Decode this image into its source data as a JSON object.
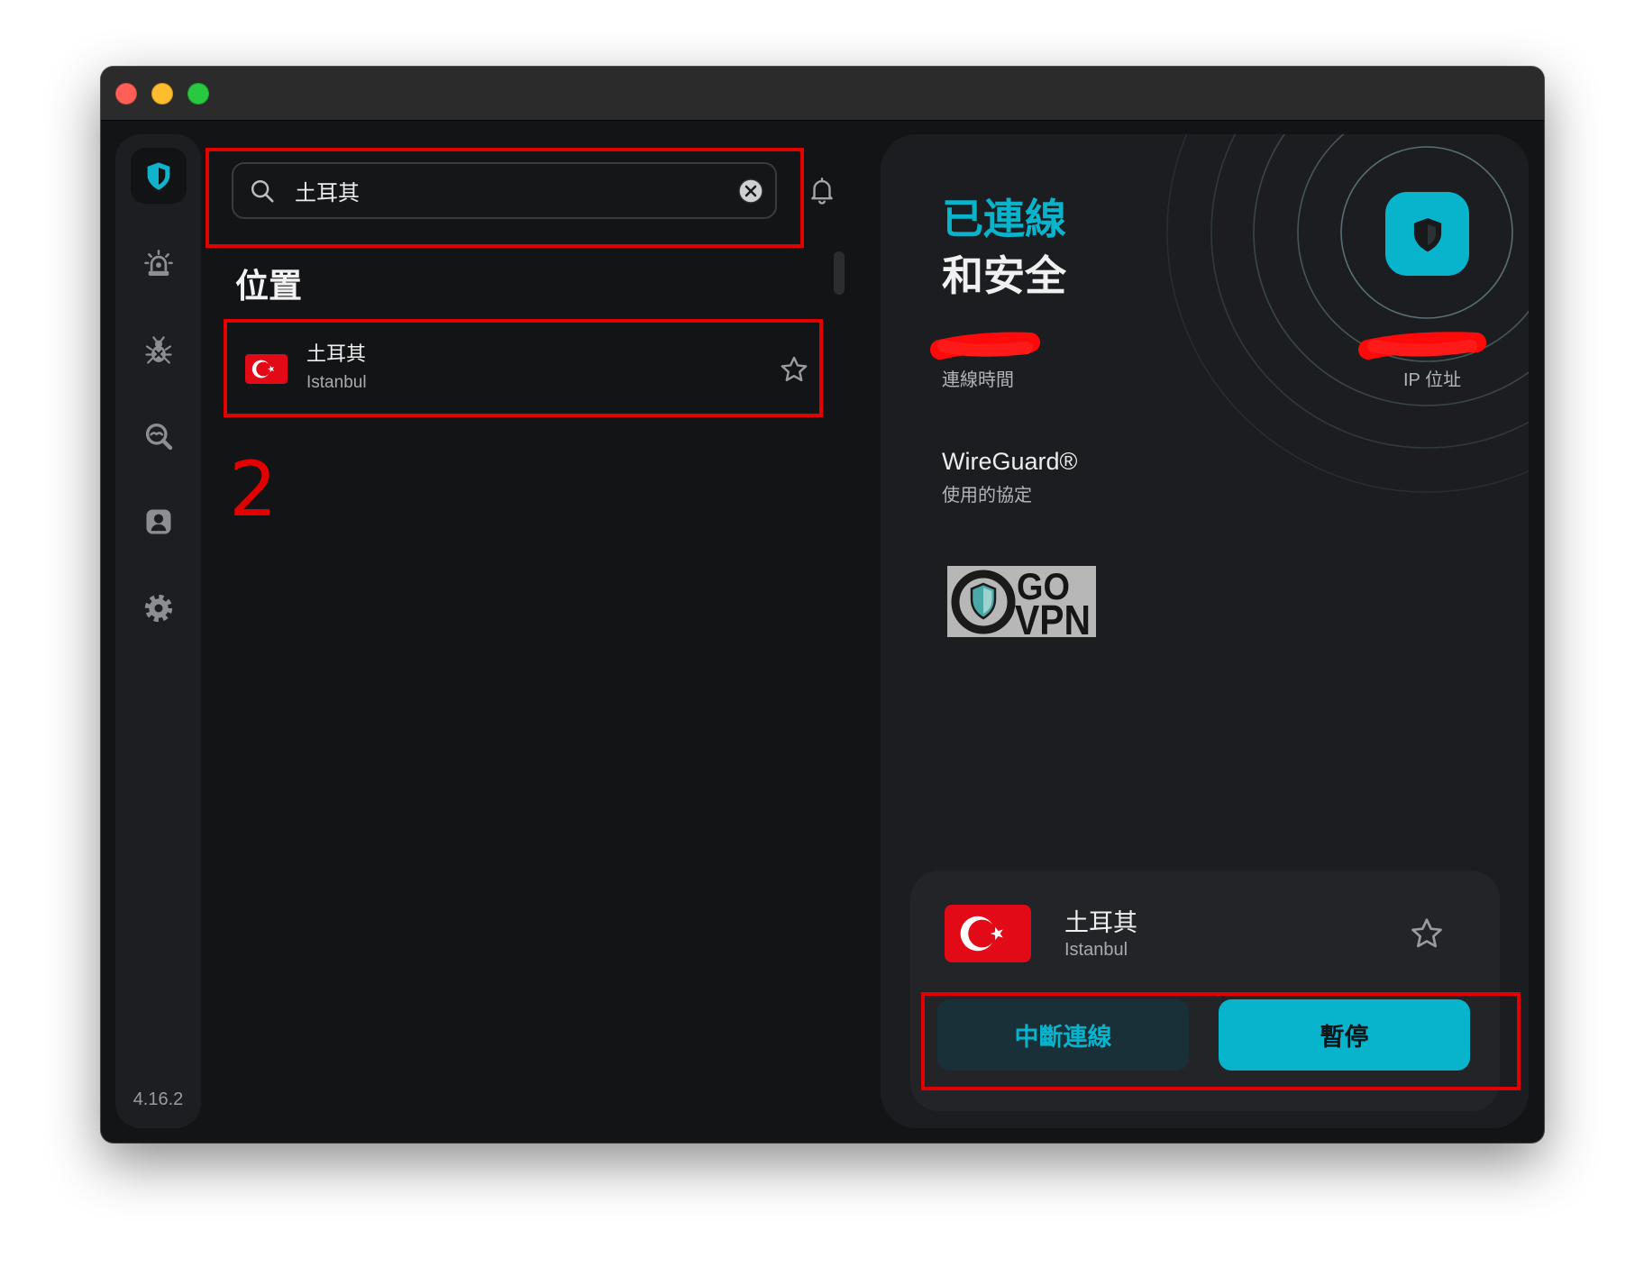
{
  "colors": {
    "accent": "#08b3cc",
    "annotation": "#e30000",
    "traffic_close": "#ff5f57",
    "traffic_minimize": "#febc2e",
    "traffic_zoom": "#28c840",
    "flag_red": "#e30a17"
  },
  "sidebar": {
    "items": [
      {
        "icon": "shield-icon",
        "active": true
      },
      {
        "icon": "alarm-icon"
      },
      {
        "icon": "bug-icon"
      },
      {
        "icon": "search-scan-icon"
      },
      {
        "icon": "user-card-icon"
      },
      {
        "icon": "gear-icon"
      }
    ],
    "version": "4.16.2"
  },
  "search": {
    "value": "土耳其",
    "icon": "search-icon",
    "clear_icon": "clear-icon"
  },
  "notifications": {
    "icon": "bell-icon"
  },
  "locations": {
    "heading": "位置",
    "items": [
      {
        "country": "土耳其",
        "city": "Istanbul",
        "flag_icon": "turkey-flag-icon",
        "favorite": false
      }
    ]
  },
  "annotation": {
    "step": "2"
  },
  "status": {
    "line1": "已連線",
    "line2": "和安全",
    "connection_time_label": "連線時間",
    "ip_label": "IP 位址",
    "protocol": "WireGuard®",
    "protocol_label": "使用的協定"
  },
  "logo": {
    "line1": "GO",
    "line2": "VPN"
  },
  "current_location": {
    "country": "土耳其",
    "city": "Istanbul",
    "favorite": false
  },
  "actions": {
    "disconnect": "中斷連線",
    "pause": "暫停"
  }
}
